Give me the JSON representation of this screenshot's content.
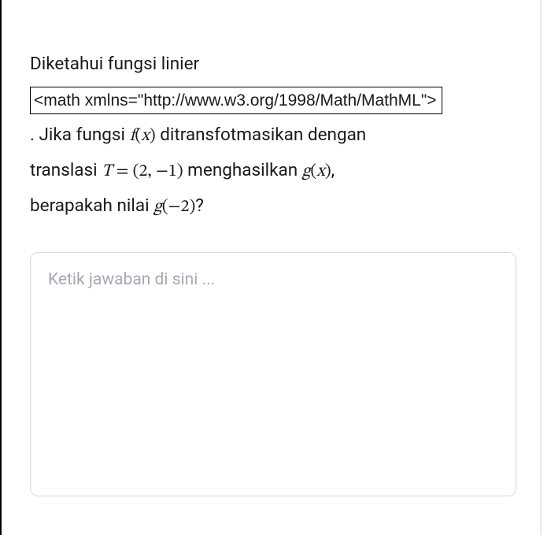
{
  "question": {
    "line1": "Diketahui fungsi linier",
    "mathml_raw": "<math xmlns=\"http://www.w3.org/1998/Math/MathML\">",
    "part_a": ". Jika fungsi ",
    "fx": "f(x)",
    "part_b": " ditransfotmasikan dengan",
    "part_c": "translasi ",
    "T_eq": "T = (2, −1)",
    "part_d": " menghasilkan ",
    "gx": "g(x)",
    "part_e": ",",
    "part_f": "berapakah nilai ",
    "gminus2": "g(−2)",
    "part_g": "?"
  },
  "answer": {
    "placeholder": "Ketik jawaban di sini ...",
    "value": ""
  }
}
